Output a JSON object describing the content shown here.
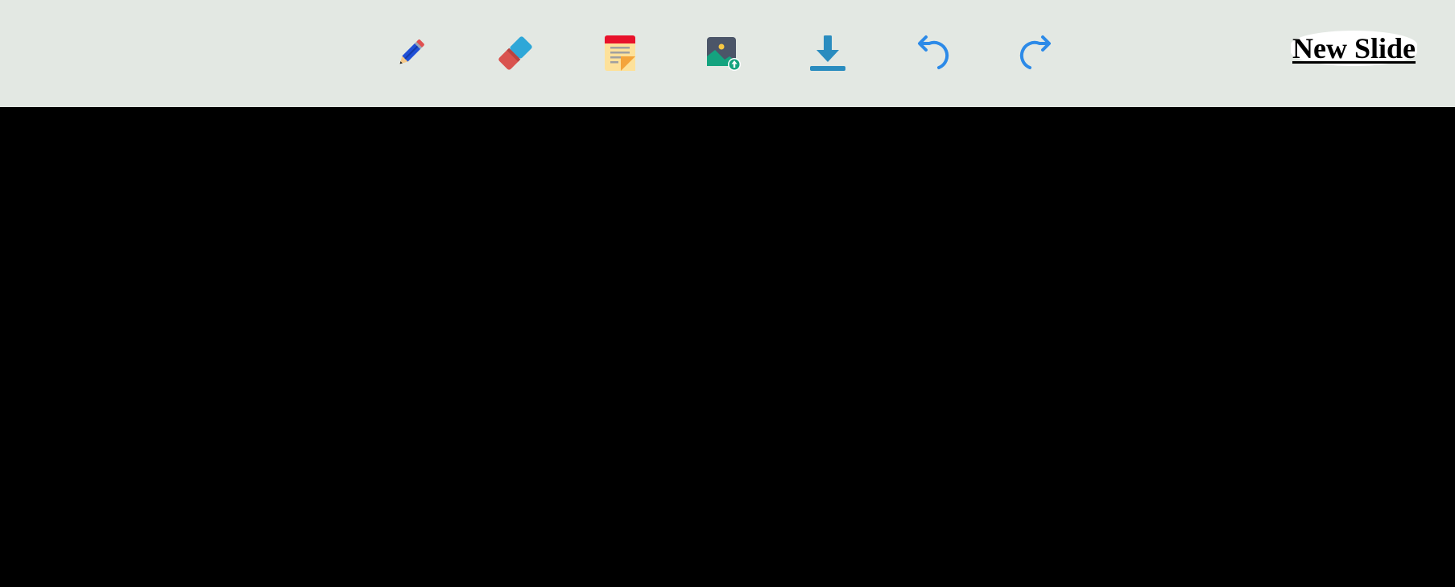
{
  "toolbar": {
    "tools": [
      {
        "id": "pencil",
        "icon": "pencil-icon"
      },
      {
        "id": "eraser",
        "icon": "eraser-icon"
      },
      {
        "id": "note",
        "icon": "sticky-note-icon"
      },
      {
        "id": "image",
        "icon": "image-upload-icon"
      },
      {
        "id": "download",
        "icon": "download-icon"
      },
      {
        "id": "undo",
        "icon": "undo-icon"
      },
      {
        "id": "redo",
        "icon": "redo-icon"
      }
    ],
    "new_slide_label": "New Slide"
  },
  "colors": {
    "toolbar_bg": "#e3e8e3",
    "canvas_bg": "#000000",
    "accent_blue": "#2c8ae8",
    "download_blue": "#2a8cbf"
  }
}
